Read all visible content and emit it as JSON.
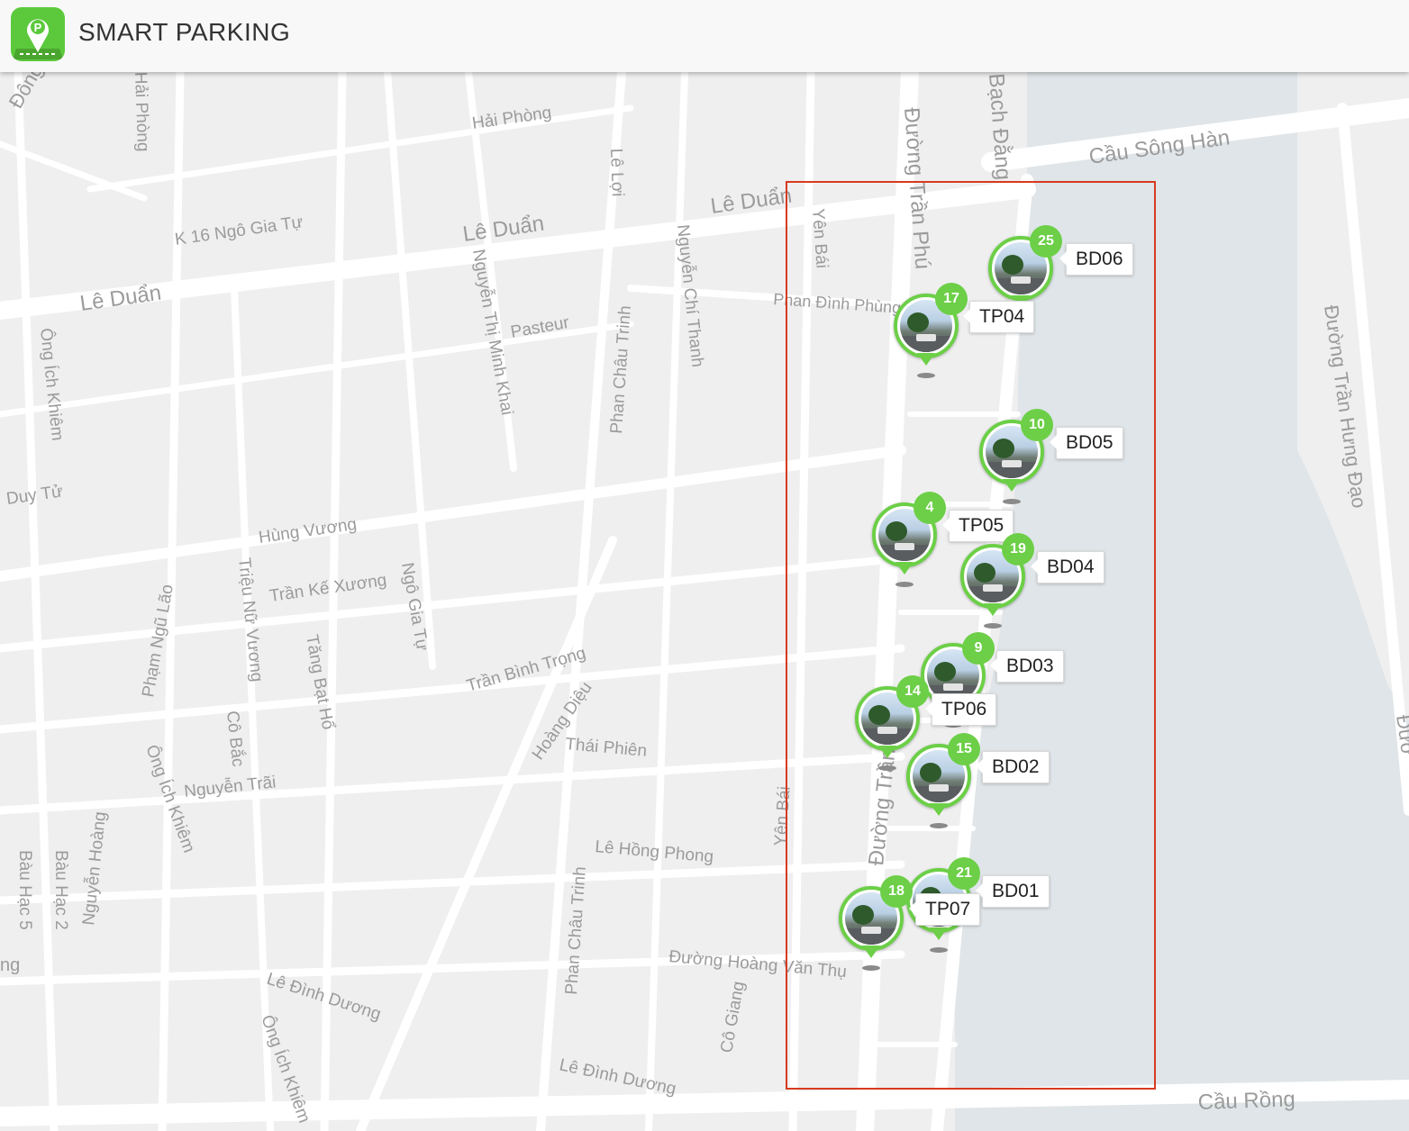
{
  "app": {
    "title": "SMART PARKING",
    "logo_icon": "parking-pin-logo-icon",
    "brand_color": "#5cc93d"
  },
  "map": {
    "marker_color": "#6ccf47",
    "selection_color": "#d83a1f",
    "water_color": "#dfe5e8",
    "street_labels": [
      "Hải Phòng",
      "Hải Phòng",
      "Lê Lợi",
      "Lê Duẩn",
      "Lê Duẩn",
      "Lê Duẩn",
      "K 16 Ngô Gia Tự",
      "Cầu Sông Hàn",
      "Đường Trần Phú",
      "Bạch Đằng",
      "Yên Bái",
      "Phan Đình Phùng",
      "Nguyễn Thị Minh Khai",
      "Nguyễn Chí Thanh",
      "Pasteur",
      "Phan Châu Trinh",
      "Ông Ích Khiêm",
      "Duy Tử",
      "Hùng Vương",
      "Trần Kế Xương",
      "Ngô Gia Tự",
      "Triệu Nữ Vương",
      "Tăng Bạt Hổ",
      "Phạm Ngũ Lão",
      "Trần Bình Trọng",
      "Hoàng Diệu",
      "Thái Phiên",
      "Cô Bắc",
      "Nguyễn Trãi",
      "Ông Ích Khiêm",
      "Lê Hồng Phong",
      "Yên Bái",
      "Đường Trần",
      "Bàu Hạc 5",
      "Bàu Hạc 2",
      "Nguyễn Hoàng",
      "Phan Châu Trinh",
      "Đường Hoàng Văn Thụ",
      "Lê Đình Dương",
      "Ông Ích Khiêm",
      "Cô Giang",
      "Lê Đình Dương",
      "Cầu Rồng",
      "Đường Trần Hưng Đạo",
      "Đông",
      "Đườ",
      "ng"
    ]
  },
  "markers": [
    {
      "code": "BD06",
      "count": "25"
    },
    {
      "code": "TP04",
      "count": "17"
    },
    {
      "code": "BD05",
      "count": "10"
    },
    {
      "code": "TP05",
      "count": "4"
    },
    {
      "code": "BD04",
      "count": "19"
    },
    {
      "code": "BD03",
      "count": "9"
    },
    {
      "code": "TP06",
      "count": "14"
    },
    {
      "code": "BD02",
      "count": "15"
    },
    {
      "code": "BD01",
      "count": "21"
    },
    {
      "code": "TP07",
      "count": "18"
    }
  ]
}
